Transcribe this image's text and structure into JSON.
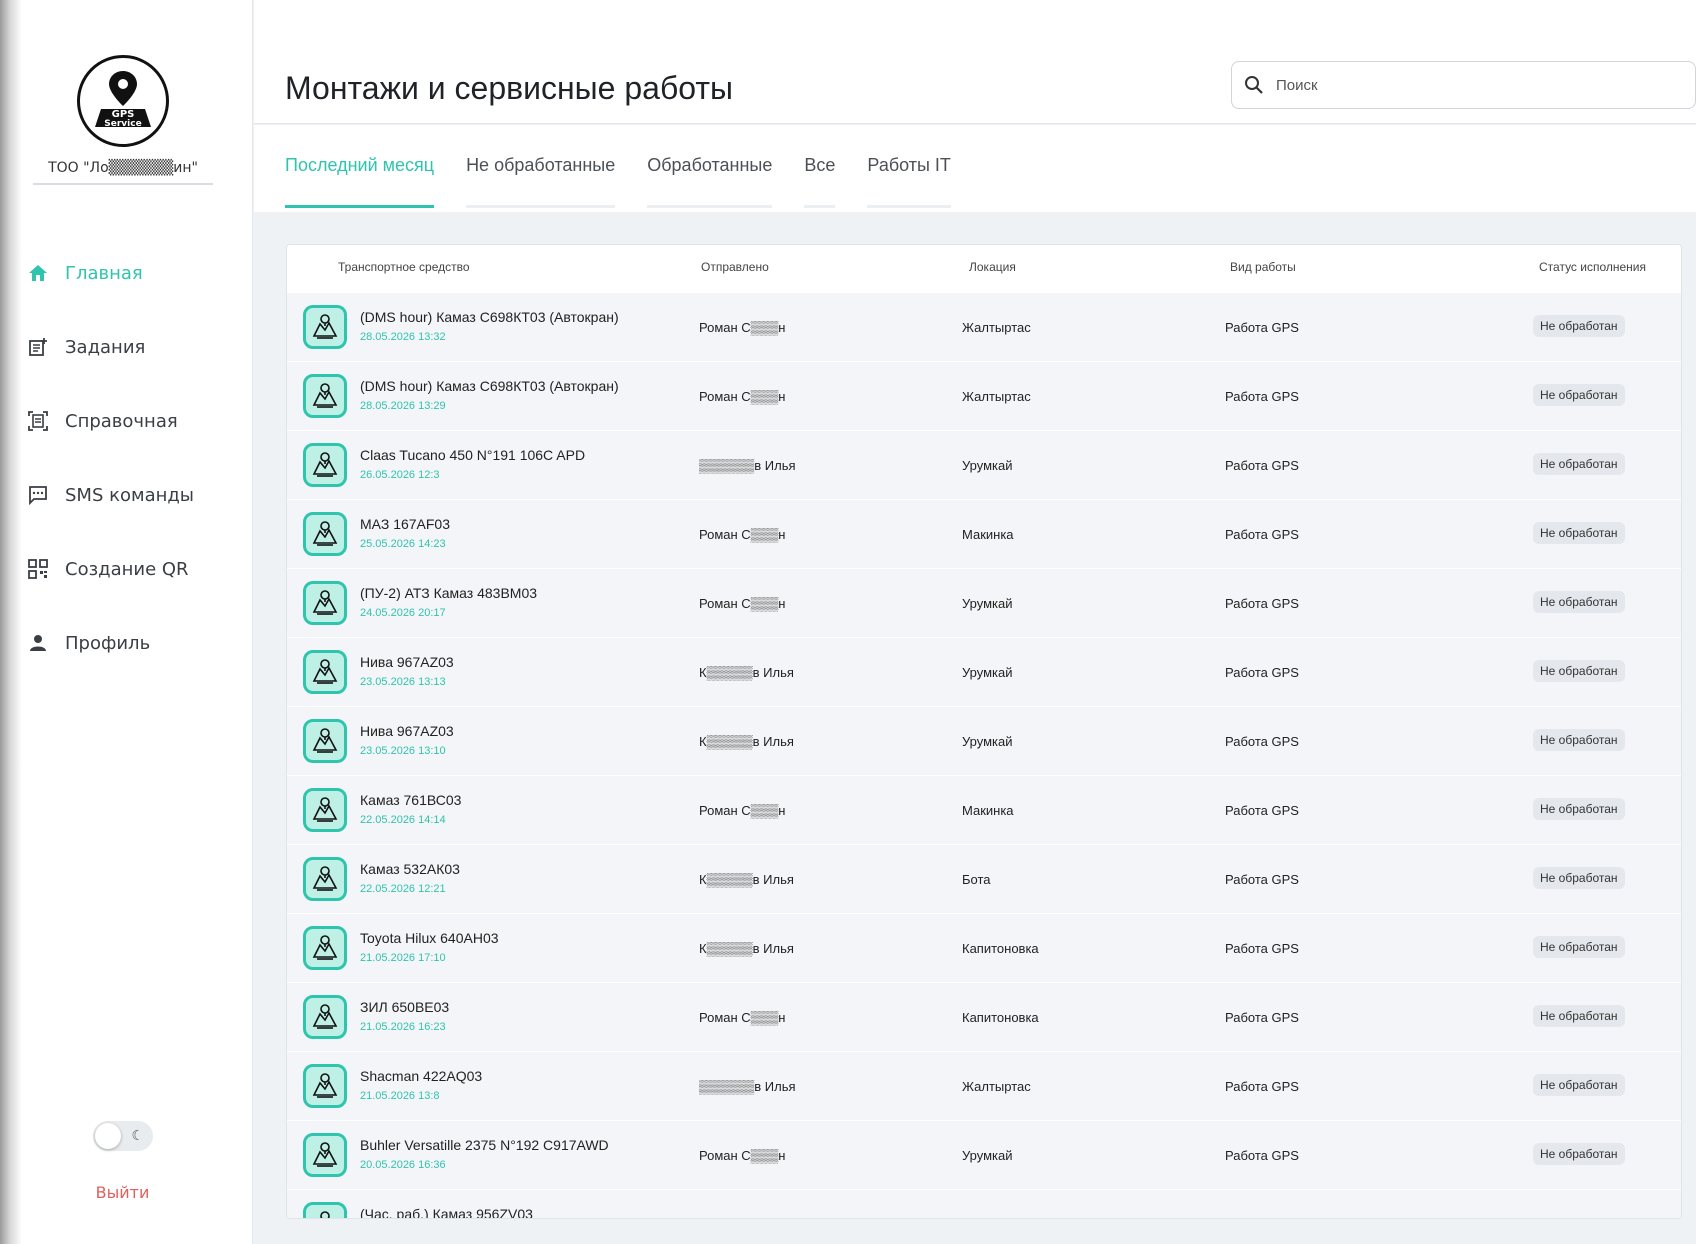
{
  "sidebar": {
    "logo_text": "GPS Service",
    "company": "ТОО \"Ло▒▒▒▒▒▒ин\"",
    "nav": [
      {
        "label": "Главная",
        "icon": "home-icon",
        "active": true
      },
      {
        "label": "Задания",
        "icon": "tasks-icon"
      },
      {
        "label": "Справочная",
        "icon": "reference-icon"
      },
      {
        "label": "SMS команды",
        "icon": "sms-icon"
      },
      {
        "label": "Создание QR",
        "icon": "qr-icon"
      },
      {
        "label": "Профиль",
        "icon": "profile-icon"
      }
    ],
    "logout": "Выйти"
  },
  "header": {
    "title": "Монтажи и сервисные работы",
    "search_placeholder": "Поиск"
  },
  "tabs": [
    {
      "label": "Последний месяц",
      "active": true
    },
    {
      "label": "Не обработанные"
    },
    {
      "label": "Обработанные"
    },
    {
      "label": "Все"
    },
    {
      "label": "Работы IT"
    }
  ],
  "table": {
    "columns": [
      "Транспортное средство",
      "Отправлено",
      "Локация",
      "Вид работы",
      "Статус исполнения"
    ],
    "rows": [
      {
        "vehicle": "(DMS hour) Камаз С698КТ03 (Автокран)",
        "date": "28.05.2026 13:32",
        "sender": "Роман С▒▒▒н",
        "location": "Жалтыртас",
        "work": "Работа GPS",
        "status": "Не обработан"
      },
      {
        "vehicle": "(DMS hour) Камаз С698КТ03 (Автокран)",
        "date": "28.05.2026 13:29",
        "sender": "Роман С▒▒▒н",
        "location": "Жалтыртас",
        "work": "Работа GPS",
        "status": "Не обработан"
      },
      {
        "vehicle": "Claas Tucano 450 N°191 106C APD",
        "date": "26.05.2026 12:3",
        "sender": "▒▒▒▒▒▒в Илья",
        "location": "Урумкай",
        "work": "Работа GPS",
        "status": "Не обработан"
      },
      {
        "vehicle": "МАЗ 167AF03",
        "date": "25.05.2026 14:23",
        "sender": "Роман С▒▒▒н",
        "location": "Макинка",
        "work": "Работа GPS",
        "status": "Не обработан"
      },
      {
        "vehicle": "(ПУ-2) АТЗ Камаз 483ВМ03",
        "date": "24.05.2026 20:17",
        "sender": "Роман С▒▒▒н",
        "location": "Урумкай",
        "work": "Работа GPS",
        "status": "Не обработан"
      },
      {
        "vehicle": "Нива 967AZ03",
        "date": "23.05.2026 13:13",
        "sender": "К▒▒▒▒▒в Илья",
        "location": "Урумкай",
        "work": "Работа GPS",
        "status": "Не обработан"
      },
      {
        "vehicle": "Нива 967AZ03",
        "date": "23.05.2026 13:10",
        "sender": "К▒▒▒▒▒в Илья",
        "location": "Урумкай",
        "work": "Работа GPS",
        "status": "Не обработан"
      },
      {
        "vehicle": "Камаз 761ВС03",
        "date": "22.05.2026 14:14",
        "sender": "Роман С▒▒▒н",
        "location": "Макинка",
        "work": "Работа GPS",
        "status": "Не обработан"
      },
      {
        "vehicle": "Камаз 532АК03",
        "date": "22.05.2026 12:21",
        "sender": "К▒▒▒▒▒в Илья",
        "location": "Бота",
        "work": "Работа GPS",
        "status": "Не обработан"
      },
      {
        "vehicle": "Toyota Hilux 640AH03",
        "date": "21.05.2026 17:10",
        "sender": "К▒▒▒▒▒в Илья",
        "location": "Капитоновка",
        "work": "Работа GPS",
        "status": "Не обработан"
      },
      {
        "vehicle": "ЗИЛ 650ВЕ03",
        "date": "21.05.2026 16:23",
        "sender": "Роман С▒▒▒н",
        "location": "Капитоновка",
        "work": "Работа GPS",
        "status": "Не обработан"
      },
      {
        "vehicle": "Shacman 422AQ03",
        "date": "21.05.2026 13:8",
        "sender": "▒▒▒▒▒▒в Илья",
        "location": "Жалтыртас",
        "work": "Работа GPS",
        "status": "Не обработан"
      },
      {
        "vehicle": "Buhler Versatille 2375 N°192 C917AWD",
        "date": "20.05.2026 16:36",
        "sender": "Роман С▒▒▒н",
        "location": "Урумкай",
        "work": "Работа GPS",
        "status": "Не обработан"
      },
      {
        "vehicle": "(Час. раб.) Камаз 956ZV03",
        "date": "",
        "sender": "",
        "location": "",
        "work": "",
        "status": ""
      }
    ]
  },
  "colors": {
    "accent": "#2fc4ad",
    "danger": "#e06060"
  }
}
